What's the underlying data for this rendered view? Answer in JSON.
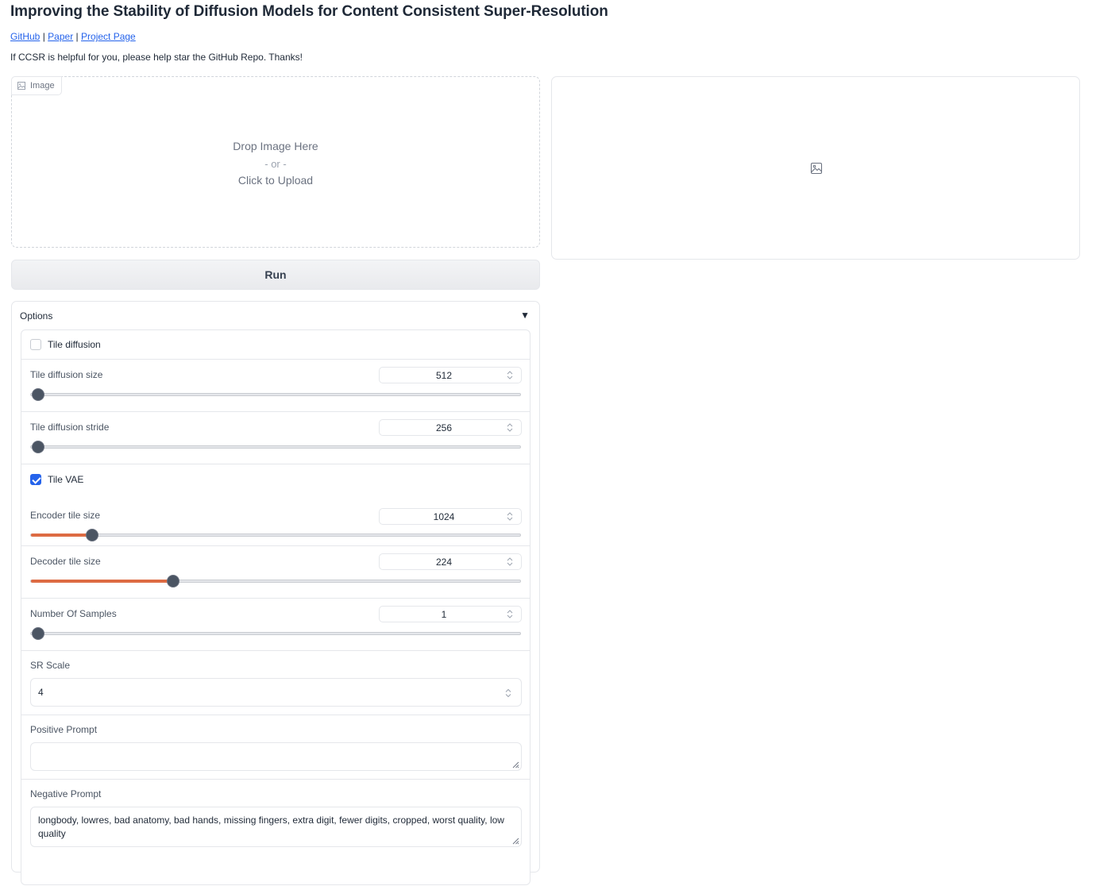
{
  "header": {
    "title": "Improving the Stability of Diffusion Models for Content Consistent Super-Resolution",
    "links": [
      "GitHub",
      "Paper",
      "Project Page"
    ],
    "separator": "|",
    "note": "If CCSR is helpful for you, please help star the GitHub Repo. Thanks!"
  },
  "upload": {
    "label": "Image",
    "drop_text": "Drop Image Here",
    "or_text": "- or -",
    "click_text": "Click to Upload"
  },
  "output": {
    "icon": "image-placeholder-icon"
  },
  "run_label": "Run",
  "options": {
    "title": "Options",
    "caret": "▼",
    "tile_diffusion": {
      "label": "Tile diffusion",
      "checked": false
    },
    "tile_diffusion_size": {
      "label": "Tile diffusion size",
      "value": "512",
      "fraction": 0.0
    },
    "tile_diffusion_stride": {
      "label": "Tile diffusion stride",
      "value": "256",
      "fraction": 0.0
    },
    "tile_vae": {
      "label": "Tile VAE",
      "checked": true
    },
    "encoder_tile_size": {
      "label": "Encoder tile size",
      "value": "1024",
      "fraction": 0.125
    },
    "decoder_tile_size": {
      "label": "Decoder tile size",
      "value": "224",
      "fraction": 0.29
    },
    "num_samples": {
      "label": "Number Of Samples",
      "value": "1",
      "fraction": 0.0
    },
    "sr_scale": {
      "label": "SR Scale",
      "value": "4"
    },
    "positive_prompt": {
      "label": "Positive Prompt",
      "value": ""
    },
    "negative_prompt": {
      "label": "Negative Prompt",
      "value": "longbody, lowres, bad anatomy, bad hands, missing fingers, extra digit, fewer digits, cropped, worst quality, low quality"
    }
  },
  "colors": {
    "accent": "#dd6b43",
    "link": "#2563eb",
    "checkbox": "#2563eb"
  }
}
